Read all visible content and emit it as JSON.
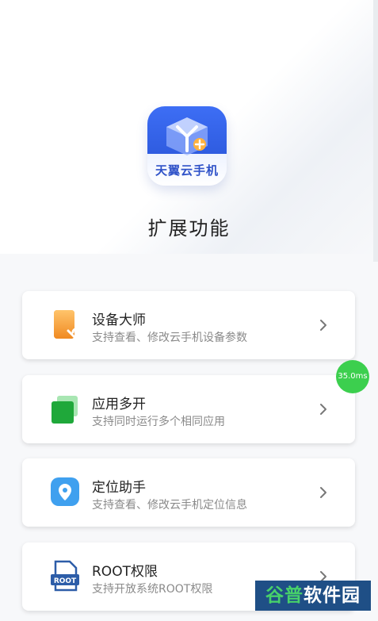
{
  "app": {
    "logo_text": "天翼云手机",
    "page_title": "扩展功能"
  },
  "cards": [
    {
      "title": "设备大师",
      "desc": "支持查看、修改云手机设备参数",
      "icon": "phone-wrench-icon"
    },
    {
      "title": "应用多开",
      "desc": "支持同时运行多个相同应用",
      "icon": "stacked-squares-icon"
    },
    {
      "title": "定位助手",
      "desc": "支持查看、修改云手机定位信息",
      "icon": "location-pin-icon"
    },
    {
      "title": "ROOT权限",
      "desc": "支持开放系统ROOT权限",
      "icon": "root-file-icon",
      "icon_label": "ROOT"
    }
  ],
  "overlay": {
    "latency_badge": "35.0ms",
    "watermark_part1": "谷普",
    "watermark_part2": "软件园"
  },
  "colors": {
    "brand_blue": "#2f5ce0",
    "card_bg": "#ffffff",
    "badge_green": "#3ccf4e"
  }
}
